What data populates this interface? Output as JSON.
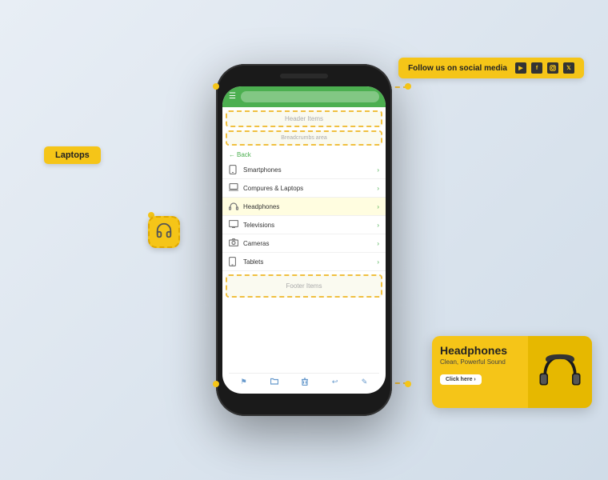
{
  "social_bar": {
    "text": "Follow us on social media",
    "icons": [
      "▶",
      "f",
      "✦",
      "𝕏"
    ]
  },
  "laptops_label": "Laptops",
  "back_button": "← Back",
  "header_items_label": "Header Items",
  "breadcrumbs_label": "Breadcrumbs area",
  "footer_items_label": "Footer Items",
  "menu_items": [
    {
      "icon": "📱",
      "label": "Smartphones"
    },
    {
      "icon": "💻",
      "label": "Compures & Laptops",
      "highlighted": false
    },
    {
      "icon": "🎧",
      "label": "Headphones",
      "highlighted": true
    },
    {
      "icon": "📺",
      "label": "Televisions"
    },
    {
      "icon": "📷",
      "label": "Cameras"
    },
    {
      "icon": "📟",
      "label": "Tablets"
    }
  ],
  "promo_card": {
    "title": "Headphones",
    "description": "Clean, Powerful Sound",
    "button_label": "Click here ›"
  },
  "bottom_nav_icons": [
    "⚑",
    "☰",
    "🗑",
    "↩",
    "✎"
  ],
  "click_here_footer": "Click here Footer Items"
}
